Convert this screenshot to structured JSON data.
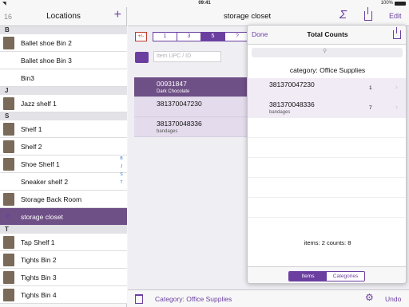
{
  "status": {
    "time": "09:41",
    "battery": "100%"
  },
  "sidebar": {
    "count": "16",
    "title": "Locations",
    "sections": [
      {
        "letter": "B",
        "items": [
          "Ballet shoe Bin 2",
          "Ballet shoe Bin 3",
          "Bin3"
        ]
      },
      {
        "letter": "J",
        "items": [
          "Jazz shelf 1"
        ]
      },
      {
        "letter": "S",
        "items": [
          "Shelf 1",
          "Shelf 2",
          "Shoe Shelf 1",
          "Sneaker shelf 2",
          "Storage Back Room",
          "storage closet"
        ]
      },
      {
        "letter": "T",
        "items": [
          "Tap Shelf 1",
          "Tights Bin 2",
          "Tights Bin 3",
          "Tights Bin 4"
        ]
      }
    ],
    "index_letters": [
      "B",
      "J",
      "S",
      "T"
    ]
  },
  "main": {
    "title": "storage closet",
    "edit": "Edit",
    "plusminus": "+/-",
    "segments": [
      "1",
      "3",
      "5",
      "?"
    ],
    "selected_segment": "5",
    "upc_placeholder": "Item UPC / ID",
    "items": [
      {
        "code": "00931847",
        "sub": "Dark Chocolate"
      },
      {
        "code": "381370047230",
        "sub": ""
      },
      {
        "code": "381370048336",
        "sub": "bandages"
      }
    ],
    "category": "Category: Office Supplies",
    "undo": "Undo"
  },
  "popover": {
    "done": "Done",
    "title": "Total Counts",
    "category": "category: Office Supplies",
    "rows": [
      {
        "code": "381370047230",
        "sub": "",
        "count": "1"
      },
      {
        "code": "381370048336",
        "sub": "bandages",
        "count": "7"
      }
    ],
    "summary": "items: 2   counts: 8",
    "tabs": [
      "Items",
      "Categories"
    ],
    "selected_tab": "Items"
  },
  "colors": {
    "accent": "#6b3fa0",
    "selected_row": "#6e4f86",
    "warning": "#c0392b"
  }
}
